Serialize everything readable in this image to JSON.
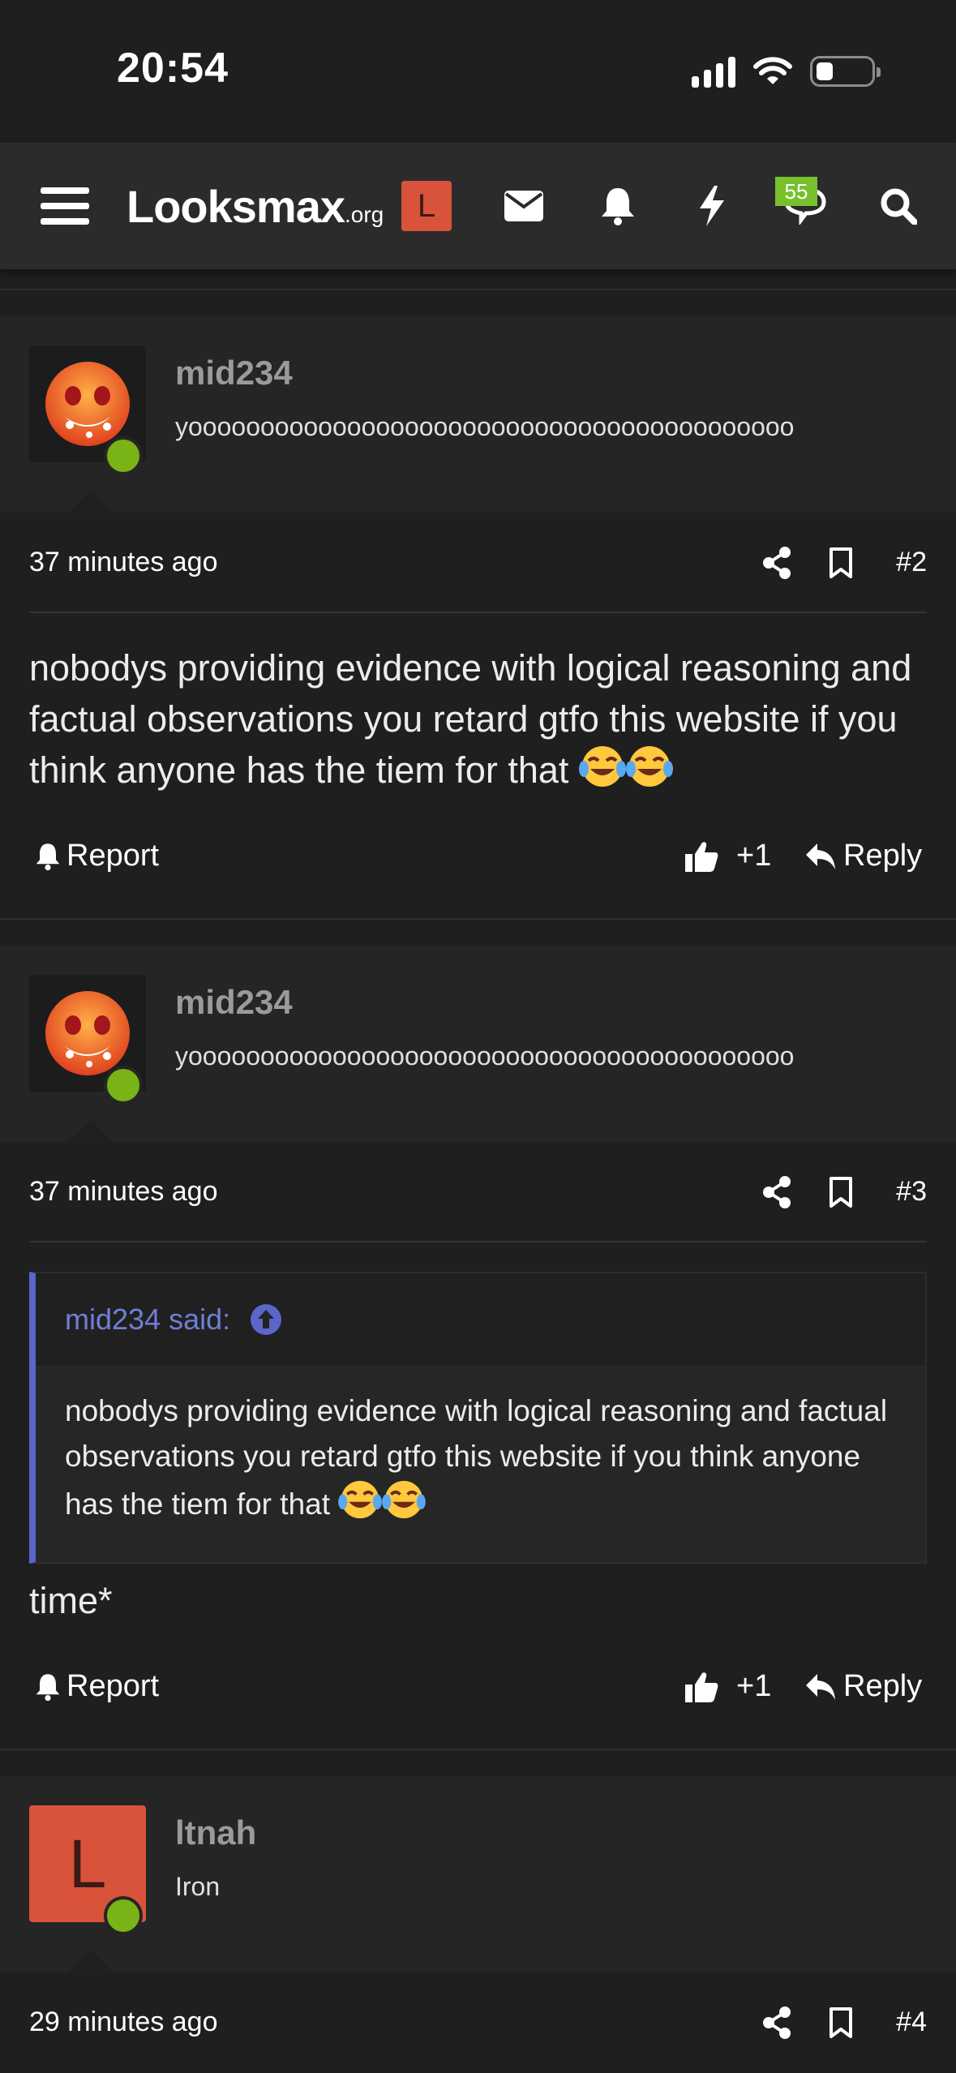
{
  "status_bar": {
    "time": "20:54"
  },
  "navbar": {
    "logo_main": "Looksmax",
    "logo_suffix": ".org",
    "user_initial": "L",
    "notification_count": "55"
  },
  "posts": [
    {
      "username": "mid234",
      "user_title": "yoooooooooooooooooooooooooooooooooooooooooo",
      "time": "37 minutes ago",
      "number": "#2",
      "body": "nobodys providing evidence with logical reasoning and factual observations you retard gtfo this website if you think anyone has the tiem for that",
      "report_label": "Report",
      "likes_label": "+1",
      "reply_label": "Reply"
    },
    {
      "username": "mid234",
      "user_title": "yoooooooooooooooooooooooooooooooooooooooooo",
      "time": "37 minutes ago",
      "number": "#3",
      "quote_author": "mid234 said:",
      "quote_body": "nobodys providing evidence with logical reasoning and factual observations you retard gtfo this website if you think anyone has the tiem for that",
      "body": "time*",
      "report_label": "Report",
      "likes_label": "+1",
      "reply_label": "Reply"
    },
    {
      "username": "ltnah",
      "user_title": "Iron",
      "avatar_initial": "L",
      "time": "29 minutes ago",
      "number": "#4"
    }
  ],
  "colors": {
    "background": "#1f1f1f",
    "navbar": "#2b2b2b",
    "accent_orange": "#d9533a",
    "online_green": "#7ab317",
    "quote_blue": "#5a66c9",
    "badge_green": "#78c12c"
  }
}
